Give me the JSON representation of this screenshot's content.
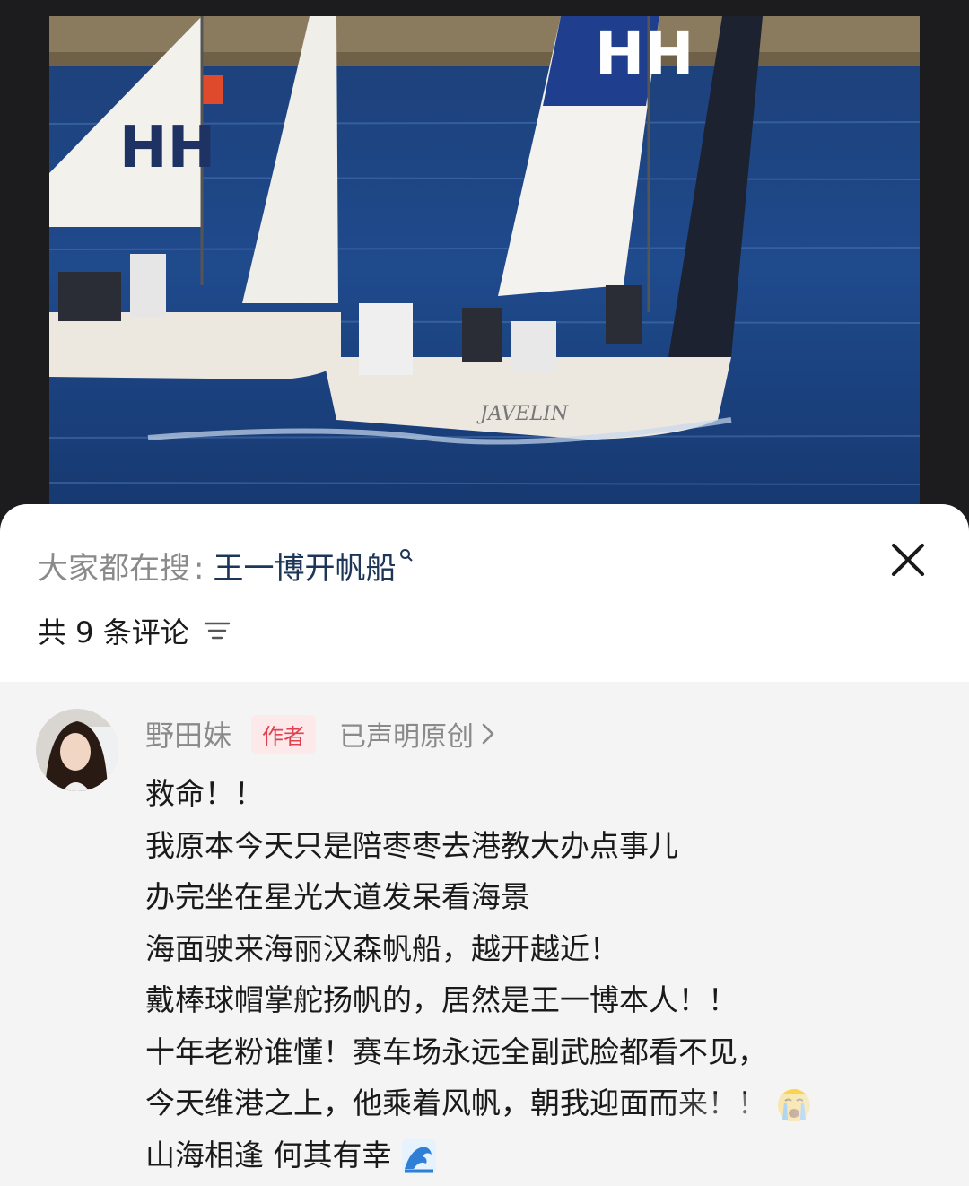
{
  "photo": {
    "description_icon": "sailing-boats-photo"
  },
  "search": {
    "prefix": "大家都在搜",
    "separator": ":",
    "term": "王一博开帆船"
  },
  "comments_header": {
    "count_label": "共 9 条评论"
  },
  "comment": {
    "username": "野田妹",
    "author_badge": "作者",
    "original_label": "已声明原创",
    "lines": [
      "救命！！",
      "我原本今天只是陪枣枣去港教大办点事儿",
      "办完坐在星光大道发呆看海景",
      "海面驶来海丽汉森帆船，越开越近！",
      "戴棒球帽掌舵扬帆的，居然是王一博本人！！",
      "十年老粉谁懂！赛车场永远全副武脸都看不见，",
      "今天维港之上，他乘着风帆，朝我迎面而来！！",
      "山海相逢 何其有幸"
    ]
  },
  "colors": {
    "badge_text": "#e0404f",
    "badge_bg": "#fde8ea",
    "link": "#1d3557"
  }
}
